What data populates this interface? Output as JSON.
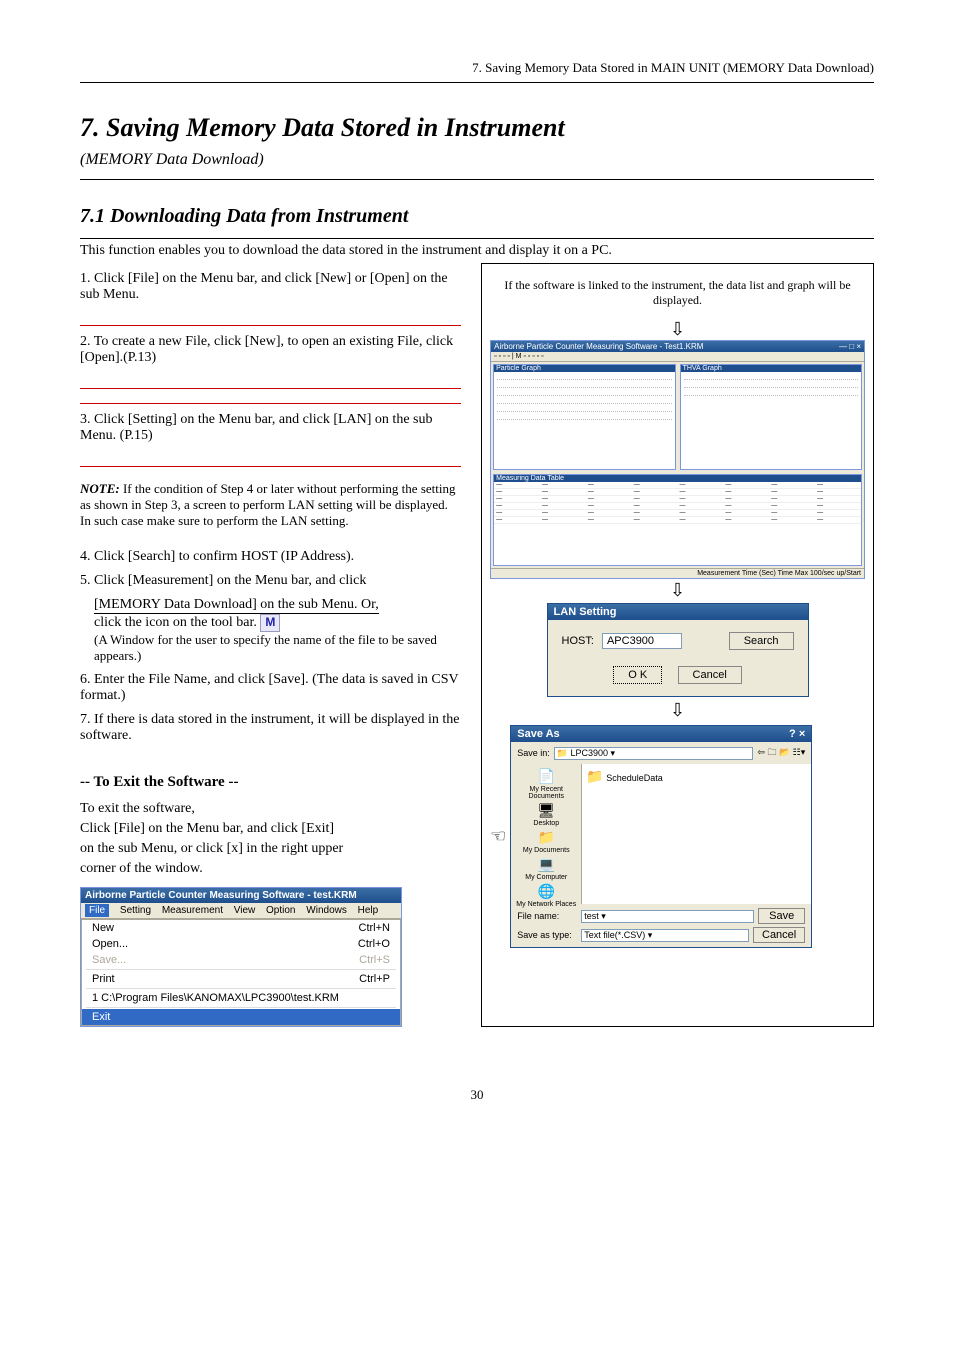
{
  "page_header": "7. Saving Memory Data Stored in MAIN UNIT (MEMORY Data Download)",
  "chapter": {
    "number_title": "7. Saving Memory Data Stored in Instrument",
    "subtitle": "(MEMORY Data Download)"
  },
  "section": {
    "title": "7.1 Downloading Data from Instrument",
    "intro": "This function enables you to download the data stored in the instrument and display it on a PC."
  },
  "steps": [
    "1. Click [File] on the Menu bar, and click [New] or [Open] on the sub Menu.",
    "2.  To create a new File, click [New], to open an existing File, click [Open].(P.13)",
    "3. Click [Setting] on the Menu bar, and click [LAN] on the sub Menu. (P.15)",
    "4. Click [Search] to confirm HOST (IP Address).",
    "5.  Click [Measurement] on the Menu bar, and click",
    "6. Enter the File Name, and click [Save]. (The data is saved in CSV format.)",
    "7.  If there is data stored in the instrument, it will be displayed in the software."
  ],
  "memory_item": "[MEMORY Data Download] on the sub Menu. Or,",
  "click_icon": "click the icon        on the tool bar.",
  "m_icon_label": "M",
  "file_specify_suffix": "(A Window for the user to specify the name of the file to be saved appears.)",
  "note": {
    "title": "NOTE:",
    "body": "If the condition of Step 4 or later without performing the setting as shown in Step 3, a screen to perform LAN setting will be displayed. In such case make sure to perform the LAN setting."
  },
  "exit": {
    "heading": "-- To Exit the Software --",
    "line1": "To exit the software,",
    "line2": "Click [File] on the Menu bar, and click [Exit]",
    "line3": "on the sub Menu, or click [x] in the right upper",
    "line4": "corner of the window."
  },
  "right_caption": "If the software is linked to the instrument, the data list and graph will be displayed.",
  "app_window": {
    "title": "Airborne Particle Counter Measuring Software - Test1.KRM",
    "panel_left": "Particle Graph",
    "panel_right": "THVA Graph",
    "grid_title": "Measuring Data Table",
    "status": "Measurement Time (Sec)   Time       Max      100/sec      up/Start"
  },
  "lan_dialog": {
    "title": "LAN Setting",
    "host_label": "HOST:",
    "host_value": "APC3900",
    "search": "Search",
    "ok": "O K",
    "cancel": "Cancel"
  },
  "save_dialog": {
    "title": "Save As",
    "help_close": "? ×",
    "save_in_label": "Save in:",
    "save_in_value": "LPC3900",
    "folder_item": "ScheduleData",
    "places": [
      "My Recent Documents",
      "Desktop",
      "My Documents",
      "My Computer",
      "My Network Places"
    ],
    "file_name_label": "File name:",
    "file_name_value": "test",
    "save_type_label": "Save as type:",
    "save_type_value": "Text file(*.CSV)",
    "save_btn": "Save",
    "cancel_btn": "Cancel"
  },
  "menu_screenshot": {
    "title": "Airborne Particle Counter Measuring Software - test.KRM",
    "menus": [
      "File",
      "Setting",
      "Measurement",
      "View",
      "Option",
      "Windows",
      "Help"
    ],
    "items": [
      {
        "label": "New",
        "accel": "Ctrl+N"
      },
      {
        "label": "Open...",
        "accel": "Ctrl+O"
      },
      {
        "label": "Save...",
        "accel": "Ctrl+S",
        "disabled": true
      },
      {
        "label": "Print",
        "accel": "Ctrl+P"
      },
      {
        "label": "1 C:\\Program Files\\KANOMAX\\LPC3900\\test.KRM",
        "accel": ""
      },
      {
        "label": "Exit",
        "accel": "",
        "highlight": true
      }
    ]
  },
  "page_number": "30"
}
